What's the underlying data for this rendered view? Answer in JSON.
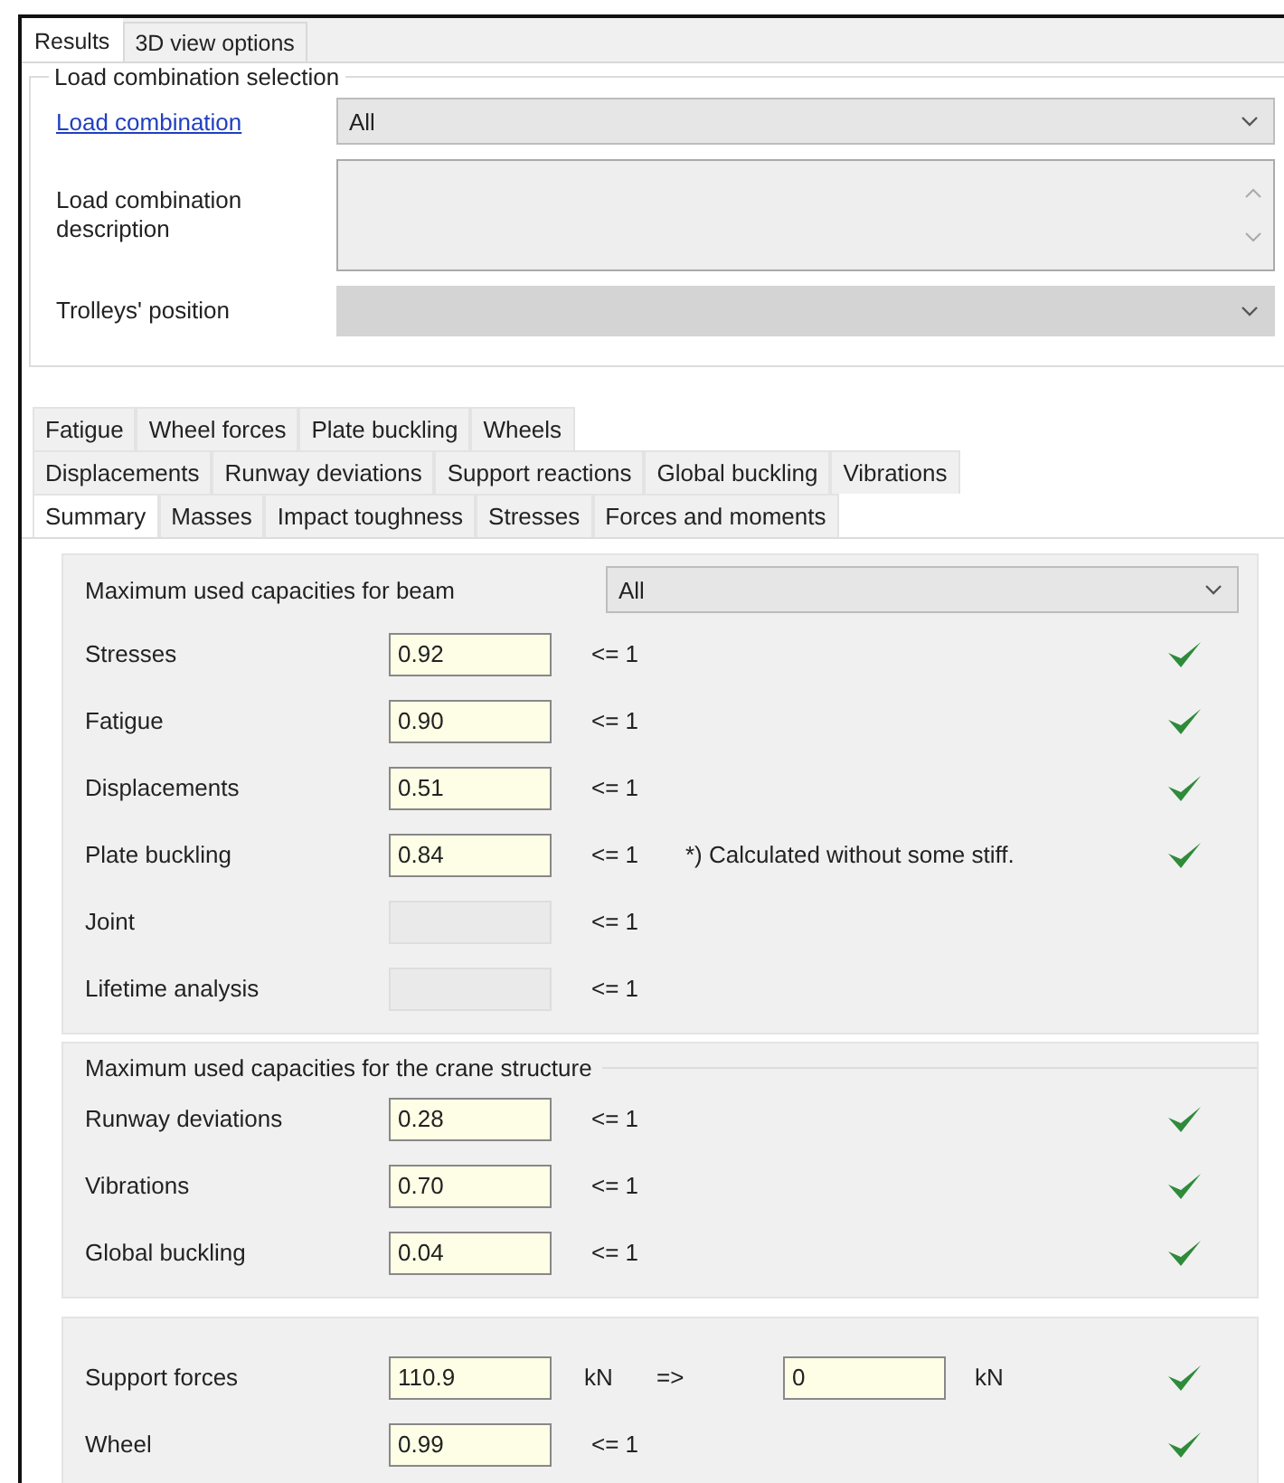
{
  "top_tabs": [
    {
      "label": "Results",
      "selected": true
    },
    {
      "label": "3D view options",
      "selected": false
    }
  ],
  "load_selection": {
    "title": "Load combination selection",
    "combination_link": "Load combination",
    "combination_value": "All",
    "description_label": "Load combination description",
    "trolleys_label": "Trolleys' position"
  },
  "result_tab_rows": [
    {
      "tabs": [
        {
          "label": "Fatigue",
          "selected": false
        },
        {
          "label": "Wheel forces",
          "selected": false
        },
        {
          "label": "Plate buckling",
          "selected": false
        },
        {
          "label": "Wheels",
          "selected": false
        }
      ]
    },
    {
      "tabs": [
        {
          "label": "Displacements",
          "selected": false
        },
        {
          "label": "Runway deviations",
          "selected": false
        },
        {
          "label": "Support reactions",
          "selected": false
        },
        {
          "label": "Global buckling",
          "selected": false
        },
        {
          "label": "Vibrations",
          "selected": false
        }
      ]
    },
    {
      "tabs": [
        {
          "label": "Summary",
          "selected": true
        },
        {
          "label": "Masses",
          "selected": false
        },
        {
          "label": "Impact toughness",
          "selected": false
        },
        {
          "label": "Stresses",
          "selected": false
        },
        {
          "label": "Forces and moments",
          "selected": false
        }
      ]
    }
  ],
  "beam_group": {
    "title": "Maximum used capacities for beam",
    "filter_value": "All",
    "rows": [
      {
        "label": "Stresses",
        "value": "0.92",
        "limit": "<= 1",
        "disabled": false,
        "ok": true
      },
      {
        "label": "Fatigue",
        "value": "0.90",
        "limit": "<= 1",
        "disabled": false,
        "ok": true
      },
      {
        "label": "Displacements",
        "value": "0.51",
        "limit": "<= 1",
        "disabled": false,
        "ok": true
      },
      {
        "label": "Plate buckling",
        "value": "0.84",
        "limit": "<= 1",
        "note": "*) Calculated without some stiff.",
        "disabled": false,
        "ok": true
      },
      {
        "label": "Joint",
        "limit": "<= 1",
        "disabled": true,
        "ok": false
      },
      {
        "label": "Lifetime analysis",
        "limit": "<= 1",
        "disabled": true,
        "ok": false
      }
    ]
  },
  "crane_group": {
    "title": "Maximum used capacities for the crane structure",
    "rows": [
      {
        "label": "Runway deviations",
        "value": "0.28",
        "limit": "<= 1",
        "disabled": false,
        "ok": true
      },
      {
        "label": "Vibrations",
        "value": "0.70",
        "limit": "<= 1",
        "disabled": false,
        "ok": true
      },
      {
        "label": "Global buckling",
        "value": "0.04",
        "limit": "<= 1",
        "disabled": false,
        "ok": true
      }
    ]
  },
  "support_group": {
    "rows": [
      {
        "kind": "force",
        "label": "Support forces",
        "value": "110.9",
        "unit": "kN",
        "arrow": "=>",
        "value2": "0",
        "unit2": "kN",
        "disabled": false,
        "ok": true
      },
      {
        "kind": "ratio",
        "label": "Wheel",
        "value": "0.99",
        "limit": "<= 1",
        "disabled": false,
        "ok": true
      }
    ]
  }
}
